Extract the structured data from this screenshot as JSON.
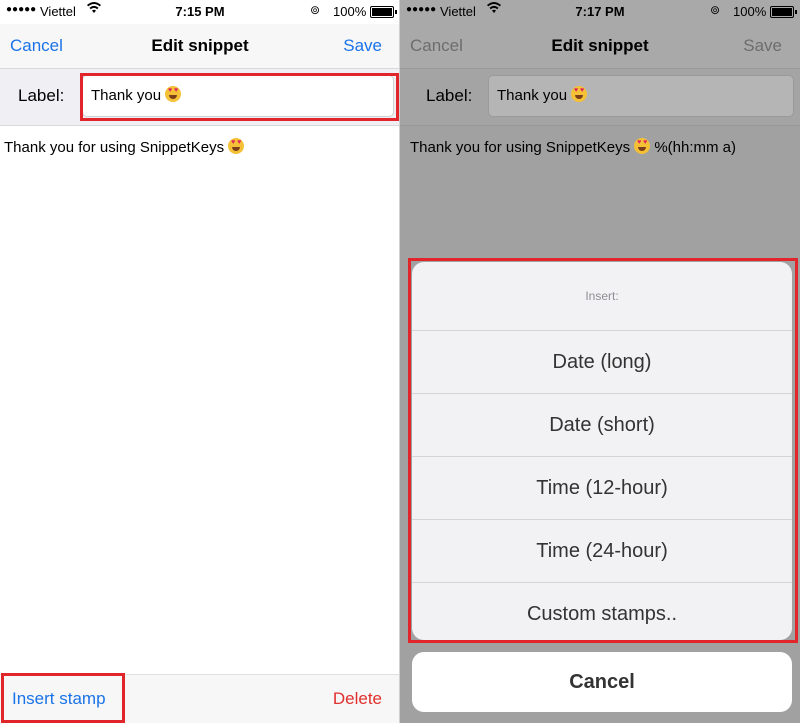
{
  "left": {
    "status": {
      "carrier": "Viettel",
      "time": "7:15 PM",
      "battery": "100%"
    },
    "nav": {
      "cancel": "Cancel",
      "title": "Edit snippet",
      "save": "Save"
    },
    "label_caption": "Label:",
    "label_value": "Thank you",
    "body_text": "Thank you for using SnippetKeys",
    "insert_stamp": "Insert stamp",
    "delete": "Delete"
  },
  "right": {
    "status": {
      "carrier": "Viettel",
      "time": "7:17 PM",
      "battery": "100%"
    },
    "nav": {
      "cancel": "Cancel",
      "title": "Edit snippet",
      "save": "Save"
    },
    "label_caption": "Label:",
    "label_value": "Thank you",
    "body_text": "Thank you for using SnippetKeys",
    "body_suffix": "%(hh:mm a)",
    "sheet": {
      "title": "Insert:",
      "items": [
        {
          "label": "Date (long)"
        },
        {
          "label": "Date (short)"
        },
        {
          "label": "Time (12-hour)"
        },
        {
          "label": "Time (24-hour)"
        },
        {
          "label": "Custom stamps.."
        }
      ],
      "cancel": "Cancel"
    }
  },
  "icons": [
    "signal-dots-icon",
    "wifi-icon",
    "rotation-lock-icon",
    "battery-icon",
    "heart-eyes-emoji-icon"
  ],
  "colors": {
    "accent": "#1a73e8",
    "destructive": "#e0302e",
    "highlight": "#e0262b"
  }
}
